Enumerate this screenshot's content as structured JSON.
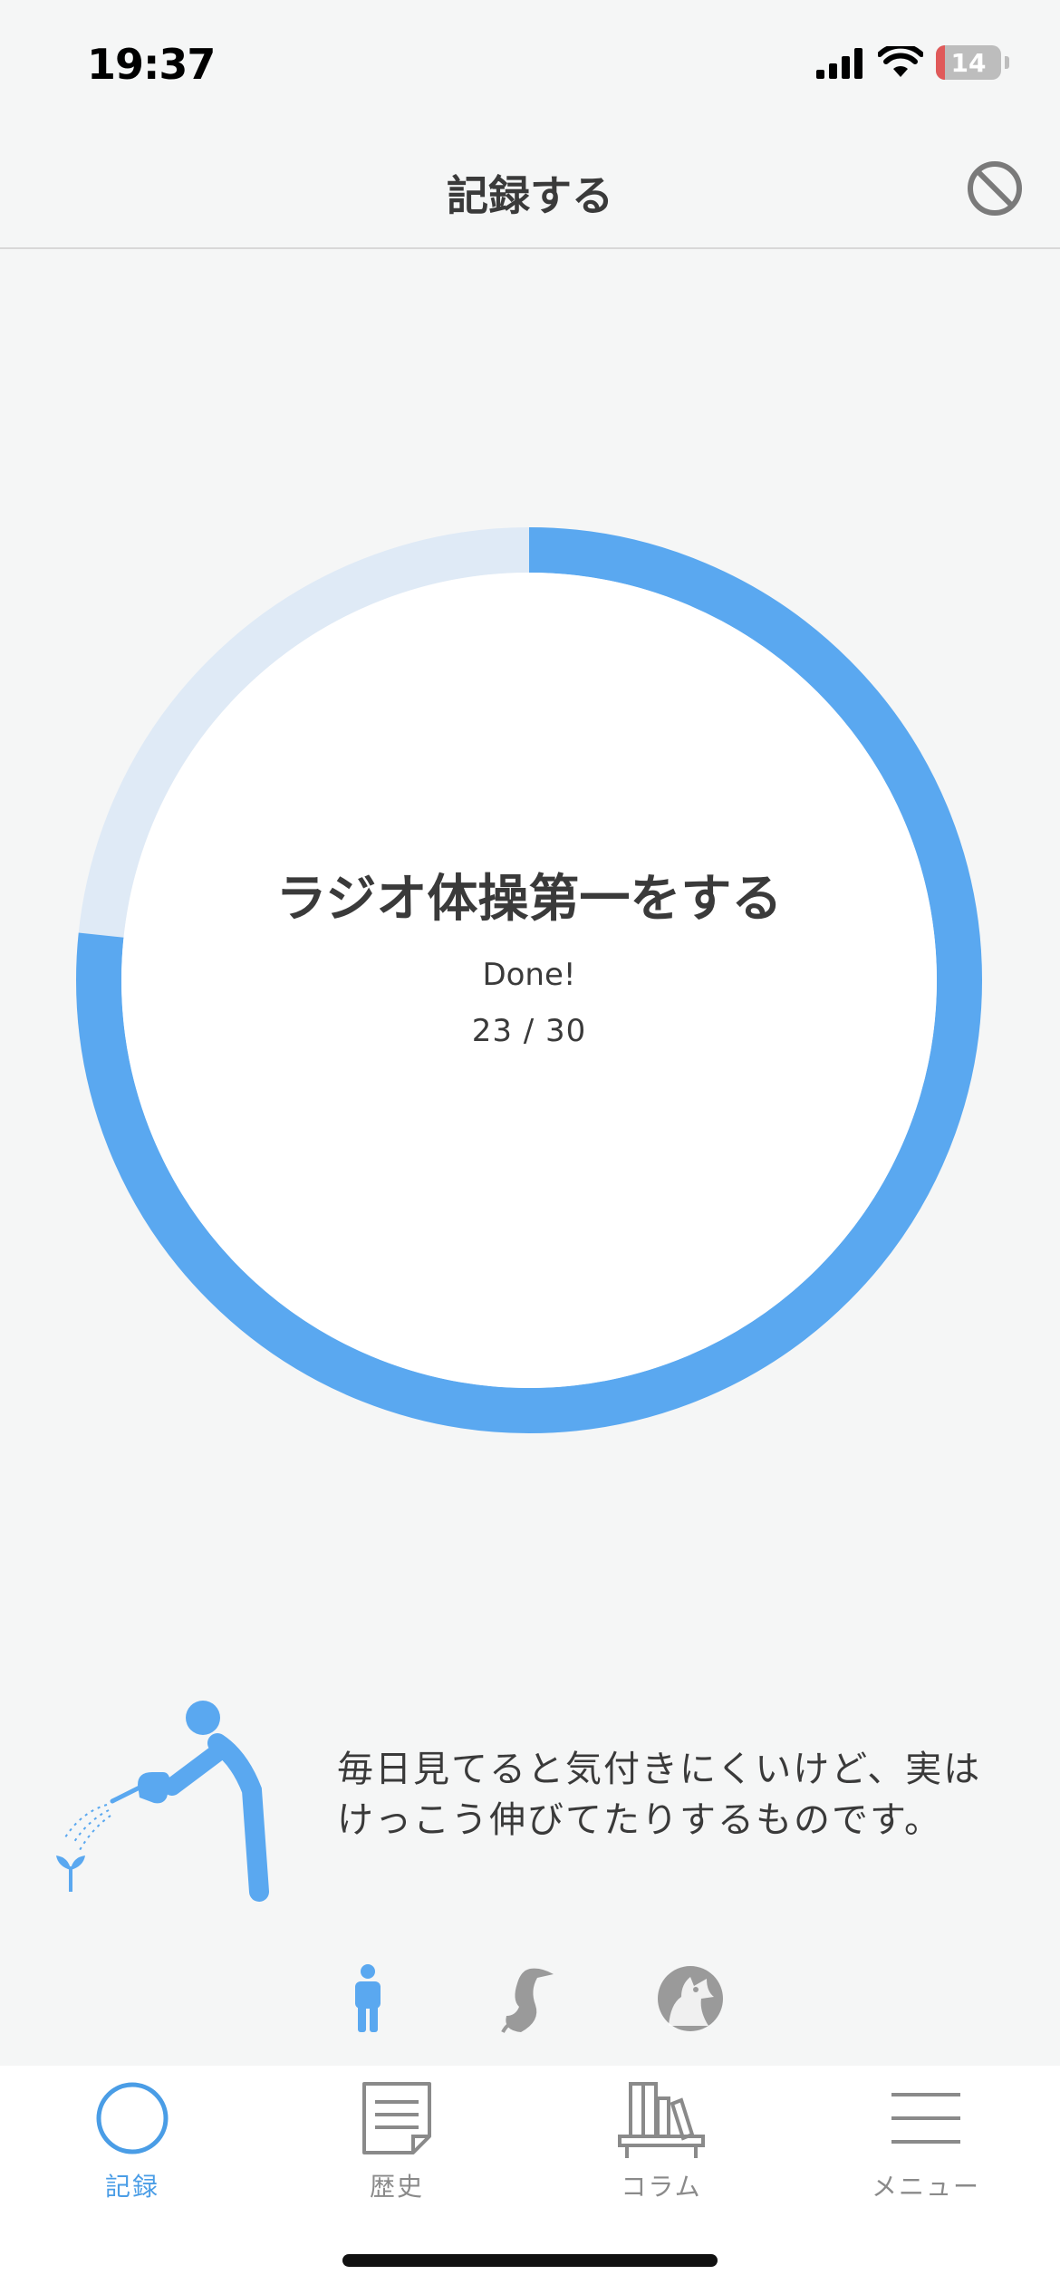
{
  "status_bar": {
    "time": "19:37",
    "battery_percent": "14",
    "battery_level": 0.14,
    "icons": [
      "cellular-signal-icon",
      "wifi-icon",
      "battery-icon"
    ]
  },
  "header": {
    "title": "記録する",
    "cancel_icon": "prohibit-icon"
  },
  "progress": {
    "habit_title": "ラジオ体操第一をする",
    "status": "Done!",
    "count_text": "23 / 30",
    "current": 23,
    "total": 30,
    "colors": {
      "progress": "#5aa8f0",
      "track": "#dfeaf6",
      "inner": "#ffffff"
    }
  },
  "tip": {
    "text": "毎日見てると気付きにくいけど、実はけっこう伸びてたりするものです。",
    "illustration": "person-watering-plant-icon"
  },
  "characters": [
    {
      "icon": "person-icon",
      "selected": true
    },
    {
      "icon": "bird-icon",
      "selected": false
    },
    {
      "icon": "wolf-icon",
      "selected": false
    }
  ],
  "tabs": [
    {
      "label": "記録",
      "icon": "circle-icon",
      "active": true
    },
    {
      "label": "歴史",
      "icon": "document-icon",
      "active": false
    },
    {
      "label": "コラム",
      "icon": "bookshelf-icon",
      "active": false
    },
    {
      "label": "メニュー",
      "icon": "menu-lines-icon",
      "active": false
    }
  ],
  "colors": {
    "accent": "#4a9de6",
    "inactive": "#8a8a8a",
    "background": "#f5f6f6"
  }
}
